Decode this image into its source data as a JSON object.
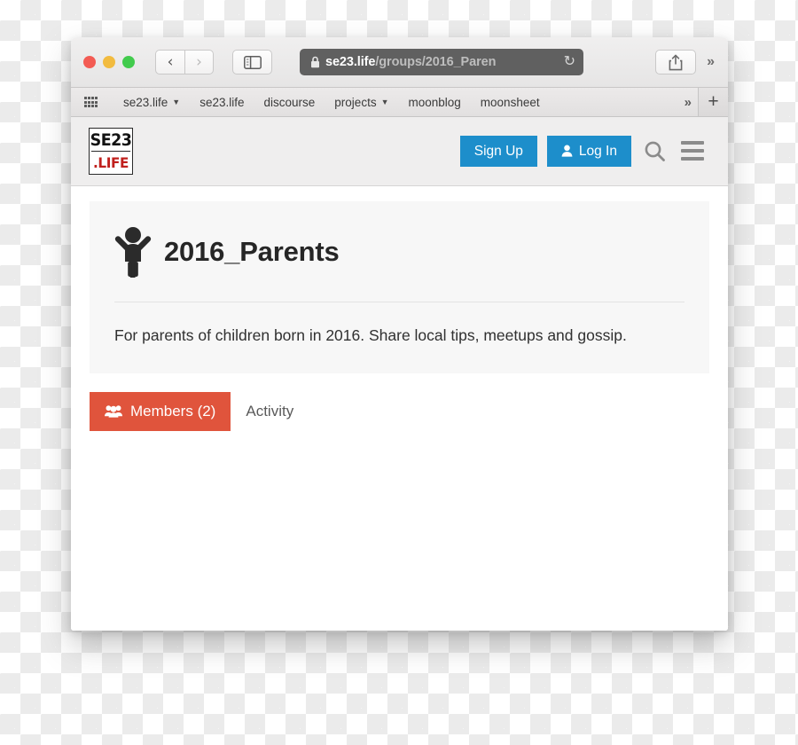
{
  "browser": {
    "traffic_lights": [
      "close",
      "minimize",
      "zoom"
    ],
    "nav": {
      "back_label": "‹",
      "forward_label": "›"
    },
    "sidebar_icon": "sidebar-icon",
    "url": {
      "lock_icon": "lock-icon",
      "host": "se23.life",
      "path": "/groups/2016_Paren",
      "reload_icon": "reload-icon"
    },
    "share_icon": "share-icon",
    "overflow_label": "»",
    "bookmarks": {
      "grid_icon": "apps-grid-icon",
      "items": [
        {
          "label": "se23.life",
          "has_dropdown": true
        },
        {
          "label": "se23.life",
          "has_dropdown": false
        },
        {
          "label": "discourse",
          "has_dropdown": false
        },
        {
          "label": "projects",
          "has_dropdown": true
        },
        {
          "label": "moonblog",
          "has_dropdown": false
        },
        {
          "label": "moonsheet",
          "has_dropdown": false
        }
      ],
      "more_label": "»",
      "new_tab_label": "+"
    }
  },
  "site": {
    "logo": {
      "top": "SE23",
      "bottom": ".LIFE"
    },
    "sign_up_label": "Sign Up",
    "log_in_label": "Log In",
    "search_icon": "search-icon",
    "menu_icon": "hamburger-menu-icon",
    "accent_blue": "#1d8ecb"
  },
  "group": {
    "avatar_icon": "child-figure-icon",
    "title": "2016_Parents",
    "description": "For parents of children born in 2016. Share local tips, meetups and gossip.",
    "tabs": [
      {
        "label": "Members (2)",
        "icon": "users-group-icon",
        "active": true
      },
      {
        "label": "Activity",
        "icon": "",
        "active": false
      }
    ],
    "accent_orange": "#e0543c"
  }
}
